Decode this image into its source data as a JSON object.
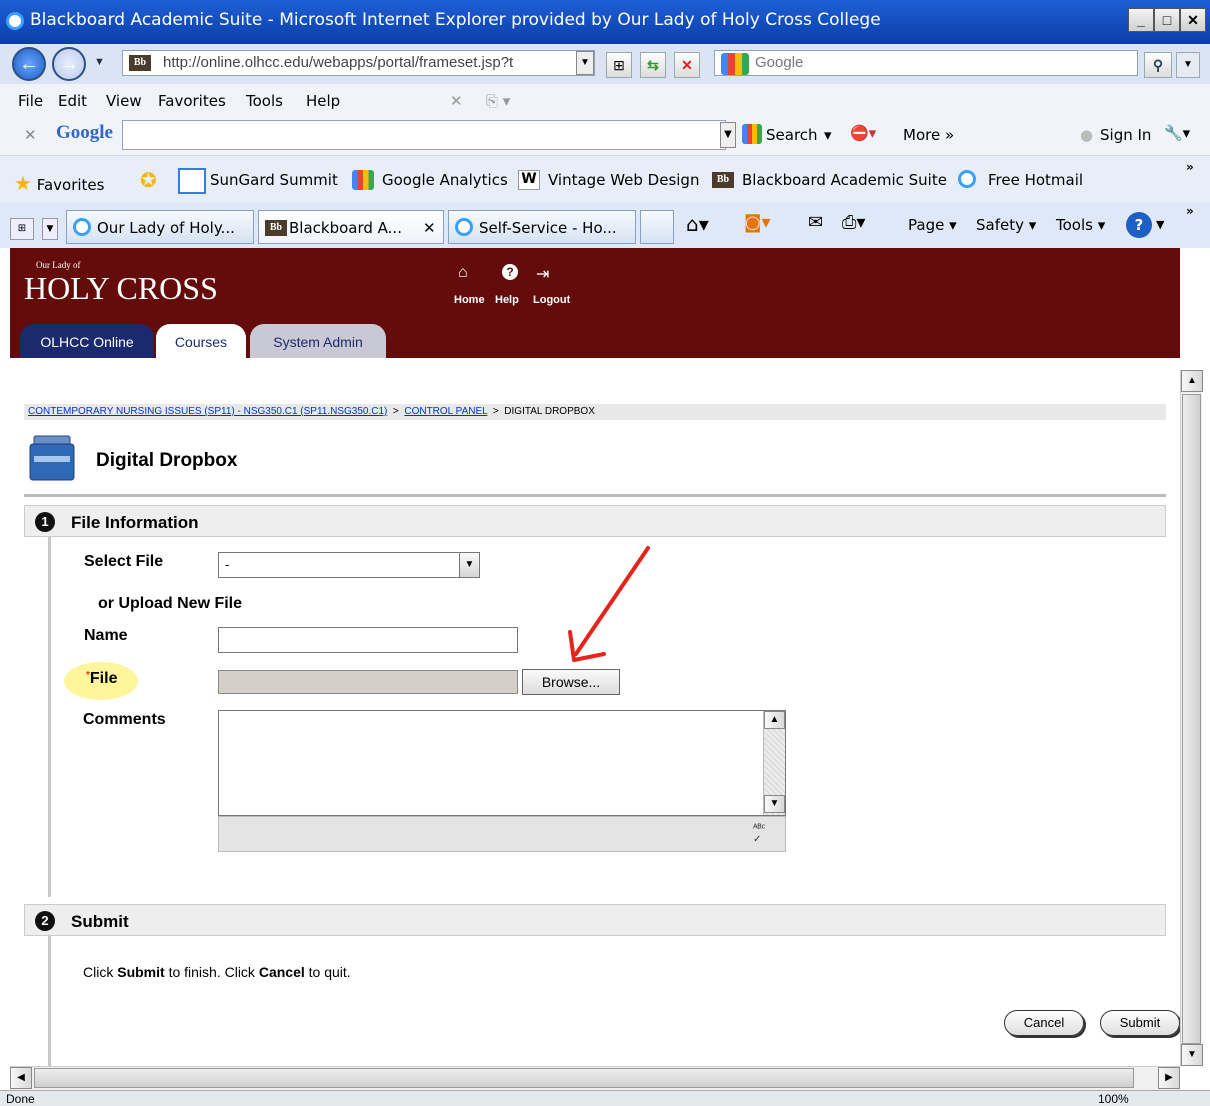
{
  "browser": {
    "window_title": "Blackboard Academic Suite - Microsoft Internet Explorer provided by Our Lady of Holy Cross College",
    "address": "http://online.olhcc.edu/webapps/portal/frameset.jsp?t",
    "search_engine": "Google",
    "menu": [
      "File",
      "Edit",
      "View",
      "Favorites",
      "Tools",
      "Help"
    ],
    "google_toolbar": {
      "logo": "Google",
      "search": "Search",
      "more": "More »",
      "sign_in": "Sign In"
    },
    "favorites_label": "Favorites",
    "favorites": [
      "SunGard Summit",
      "Google Analytics",
      "Vintage Web Design",
      "Blackboard Academic Suite",
      "Free Hotmail"
    ],
    "tabs": [
      "Our Lady of Holy...",
      "Blackboard A...",
      "Self-Service - Ho..."
    ],
    "commands": [
      "Page",
      "Safety",
      "Tools"
    ],
    "status": "Done",
    "zoom": "100%"
  },
  "site": {
    "logo_small": "Our Lady of",
    "logo_big": "HOLY CROSS",
    "header_links": [
      "Home",
      "Help",
      "Logout"
    ],
    "tabs": [
      "OLHCC Online",
      "Courses",
      "System Admin"
    ],
    "active_tab": "Courses"
  },
  "page": {
    "breadcrumb": {
      "course": "CONTEMPORARY NURSING ISSUES (SP11) - NSG350.C1 (SP11.NSG350.C1)",
      "control_panel": "CONTROL PANEL",
      "current": "DIGITAL DROPBOX"
    },
    "title": "Digital Dropbox",
    "step1": {
      "num": "1",
      "label": "File Information",
      "select_file_label": "Select File",
      "select_file_value": "-",
      "upload_label": "or Upload New File",
      "name_label": "Name",
      "name_value": "",
      "file_label": "File",
      "file_value": "",
      "browse_label": "Browse...",
      "comments_label": "Comments",
      "comments_value": ""
    },
    "step2": {
      "num": "2",
      "label": "Submit",
      "instr_1": "Click ",
      "instr_submit": "Submit",
      "instr_2": " to finish. Click ",
      "instr_cancel": "Cancel",
      "instr_3": " to quit."
    },
    "cancel_label": "Cancel",
    "submit_label": "Submit"
  },
  "colors": {
    "header_bg": "#640c0c",
    "active_tab_bg": "#ffffff",
    "online_tab_bg": "#1a2a6c",
    "annotation_arrow": "#e8231c",
    "highlight": "#fff59a"
  }
}
